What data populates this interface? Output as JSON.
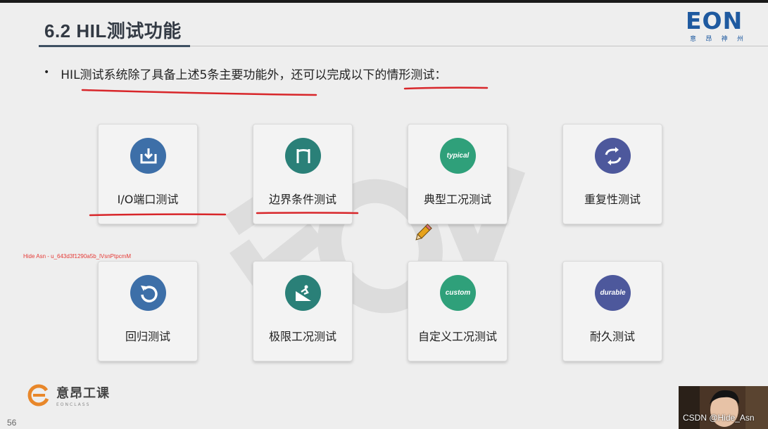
{
  "slide": {
    "title": "6.2 HIL测试功能",
    "bullet": "HIL测试系统除了具备上述5条主要功能外，还可以完成以下的情形测试：",
    "page_number": "56"
  },
  "logo": {
    "text": "EON",
    "sub": [
      "意",
      "昂",
      "神",
      "州"
    ]
  },
  "cards": [
    {
      "label": "I/O端口测试",
      "icon": "import-icon",
      "color": "#3d6fa8",
      "icon_text": ""
    },
    {
      "label": "边界条件测试",
      "icon": "boundary-icon",
      "color": "#2a8078",
      "icon_text": ""
    },
    {
      "label": "典型工况测试",
      "icon": "typical-icon",
      "color": "#2fa07a",
      "icon_text": "typical"
    },
    {
      "label": "重复性测试",
      "icon": "repeat-icon",
      "color": "#4d589c",
      "icon_text": ""
    },
    {
      "label": "回归测试",
      "icon": "undo-icon",
      "color": "#3d6fa8",
      "icon_text": ""
    },
    {
      "label": "极限工况测试",
      "icon": "ski-slope-icon",
      "color": "#2a8078",
      "icon_text": ""
    },
    {
      "label": "自定义工况测试",
      "icon": "custom-icon",
      "color": "#2fa07a",
      "icon_text": "custom"
    },
    {
      "label": "耐久测试",
      "icon": "durable-icon",
      "color": "#4d589c",
      "icon_text": "durable"
    }
  ],
  "red_note": "Hide Asn - u_643d3f1290a5b_lVsnPtpcmM",
  "footer": {
    "brand": "意昂工课",
    "brand_sub": "EONCLASS"
  },
  "webcam": {
    "caption": "CSDN @Hide_Asn"
  },
  "colors": {
    "annotation_red": "#d8262a",
    "title_rule": "#3e5062",
    "brand_blue": "#1f5aa0"
  }
}
